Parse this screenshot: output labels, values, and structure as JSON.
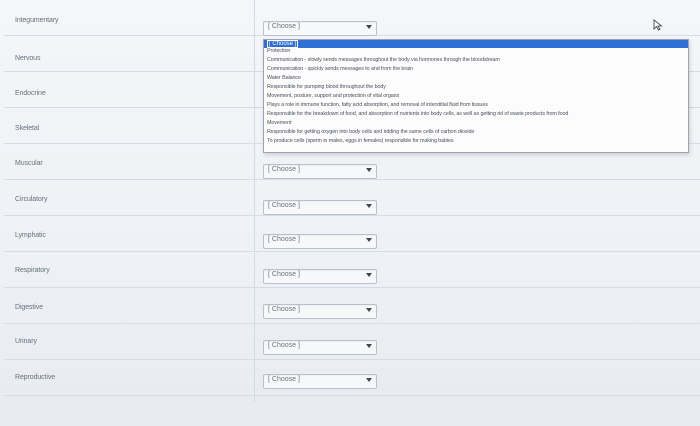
{
  "rows": [
    {
      "term": "Integumentary",
      "select_value": "[ Choose ]"
    },
    {
      "term": "Nervous",
      "select_value": "[ Choose ]"
    },
    {
      "term": "Endocrine",
      "select_value": "[ Choose ]"
    },
    {
      "term": "Skeletal",
      "select_value": "[ Choose ]"
    },
    {
      "term": "Muscular",
      "select_value": "[ Choose ]"
    },
    {
      "term": "Circulatory",
      "select_value": "[ Choose ]"
    },
    {
      "term": "Lymphatic",
      "select_value": "[ Choose ]"
    },
    {
      "term": "Respiratory",
      "select_value": "[ Choose ]"
    },
    {
      "term": "Digestive",
      "select_value": "[ Choose ]"
    },
    {
      "term": "Urinary",
      "select_value": "[ Choose ]"
    },
    {
      "term": "Reproductive",
      "select_value": "[ Choose ]"
    }
  ],
  "dropdown": {
    "highlighted": "[ Choose ]",
    "options": [
      "Protection",
      "Communication - slowly sends messages throughout the body via hormones through the bloodstream",
      "Communication - quickly sends messages to and from the brain",
      "Water Balance",
      "Responsible for pumping blood throughout the body",
      "Movement, posture, support and protection of vital organs",
      "Plays a role in immune function, fatty acid absorption, and removal of interstitial fluid from tissues",
      "Responsible for the breakdown of food, and absorption of nutrients into body cells, as well as getting rid of waste products from food",
      "Movement",
      "Responsible for getting oxygen into body cells and ridding the same cells of carbon dioxide",
      "To produce cells (sperm in males, eggs in females) responsible for making babies"
    ]
  },
  "colors": {
    "highlight": "#2f6fd6",
    "background": "#eef1f5"
  }
}
